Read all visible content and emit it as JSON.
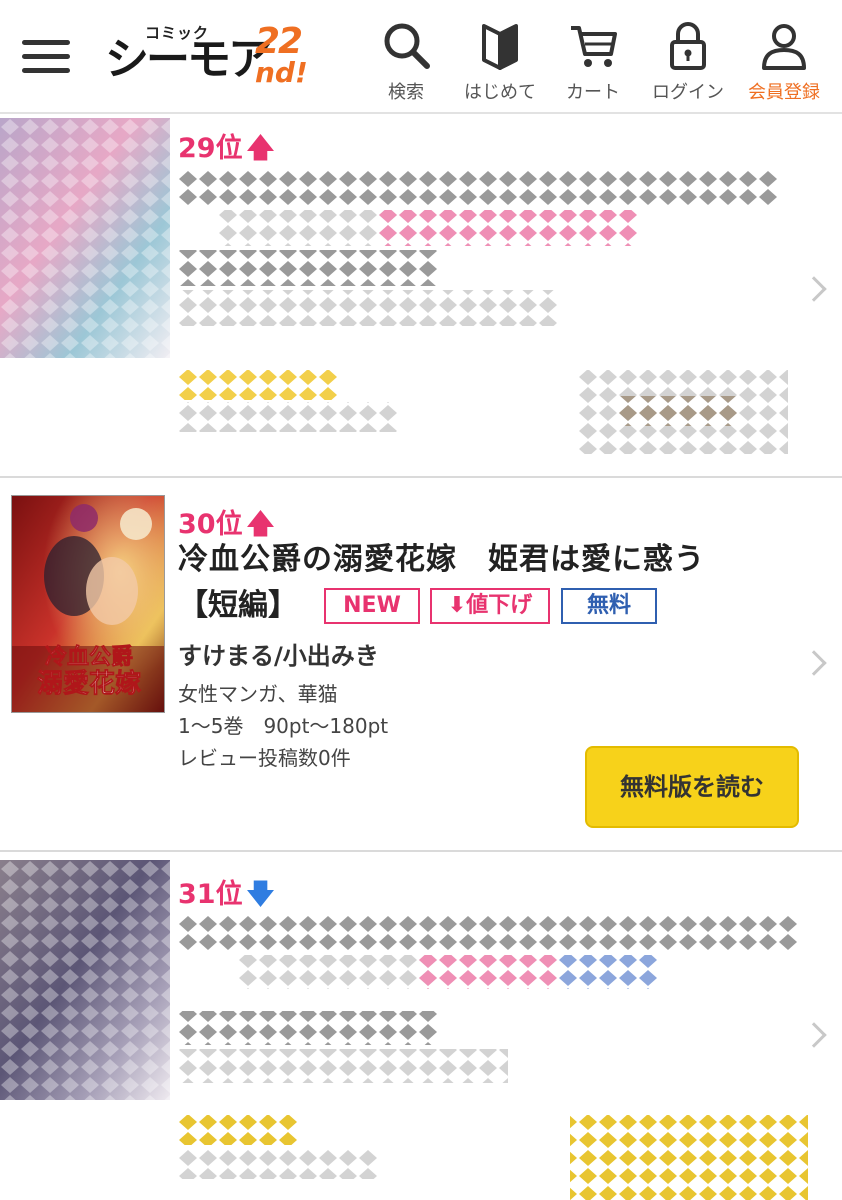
{
  "header": {
    "logo_small": "コミック",
    "logo_main": "シーモア",
    "logo_num": "22",
    "logo_suffix": "nd!",
    "nav": [
      {
        "label": "検索",
        "icon": "search-icon"
      },
      {
        "label": "はじめて",
        "icon": "book-icon"
      },
      {
        "label": "カート",
        "icon": "cart-icon"
      },
      {
        "label": "ログイン",
        "icon": "lock-icon"
      },
      {
        "label": "会員登録",
        "icon": "user-icon"
      }
    ]
  },
  "items": [
    {
      "rank": "29位",
      "trend": "up",
      "trend_glyph": "🡅"
    },
    {
      "rank": "30位",
      "trend": "up",
      "trend_glyph": "🡅",
      "title": "冷血公爵の溺愛花嫁　姫君は愛に惑う",
      "title_suffix": "【短編】",
      "badges": [
        "NEW",
        "⬇値下げ",
        "無料"
      ],
      "author": "すけまる/小出みき",
      "genre": "女性マンガ、華猫",
      "volumes": "1～5巻　90pt～180pt",
      "reviews": "レビュー投稿数0件",
      "read_button": "無料版を読む",
      "cover_title": "冷血公爵の溺愛花嫁"
    },
    {
      "rank": "31位",
      "trend": "down",
      "trend_glyph": "🡇"
    }
  ],
  "colors": {
    "accent": "#ef6f22",
    "rank": "#e8336f",
    "free_badge": "#2f5fb0",
    "read_button": "#f7d21a",
    "trend_down": "#2f7de1"
  }
}
